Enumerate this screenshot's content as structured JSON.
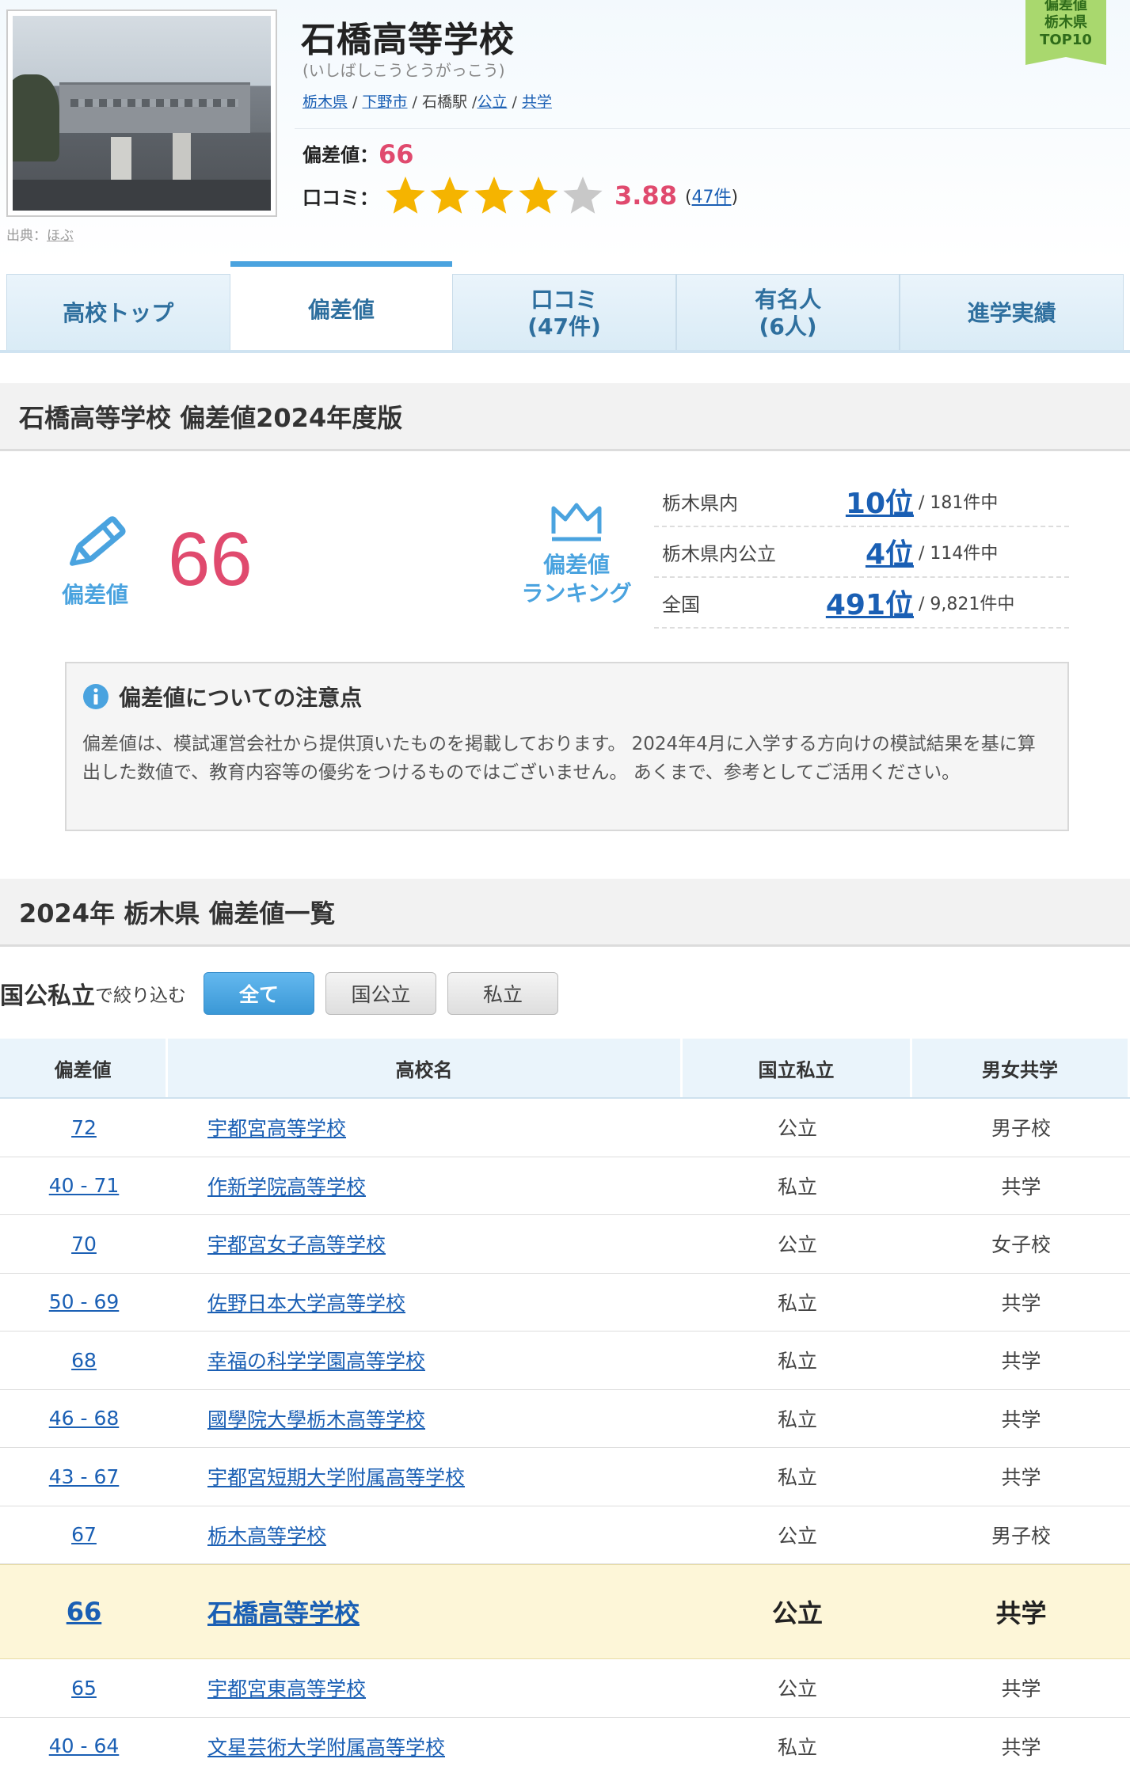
{
  "header": {
    "school_name": "石橋高等学校",
    "school_kana": "(いしばしこうとうがっこう)",
    "breadcrumb": {
      "pref": "栃木県",
      "city": "下野市",
      "sep1": " / ",
      "station": "石橋駅",
      "sep2": " /",
      "type": "公立",
      "sep3": " / ",
      "gender": "共学"
    },
    "hensachi_label": "偏差値：",
    "hensachi_value": "66",
    "review_label": "口コミ：",
    "rating": 3.88,
    "rating_text": "3.88",
    "review_count_open": "(",
    "review_count": "47件",
    "review_count_close": ")",
    "credit_label": "出典：",
    "credit_link": "ほぶ",
    "ribbon": [
      "偏差値",
      "栃木県",
      "TOP10"
    ]
  },
  "tabs": [
    {
      "line1": "高校トップ",
      "line2": ""
    },
    {
      "line1": "偏差値",
      "line2": ""
    },
    {
      "line1": "口コミ",
      "line2": "(47件)"
    },
    {
      "line1": "有名人",
      "line2": "(6人)"
    },
    {
      "line1": "進学実績",
      "line2": ""
    }
  ],
  "section1": {
    "title": "石橋高等学校 偏差値2024年度版",
    "big_label": "偏差値",
    "big_value": "66",
    "rank_label_1": "偏差値",
    "rank_label_2": "ランキング",
    "ranks": [
      {
        "label": "栃木県内",
        "value": "10位",
        "total": "/ 181件中"
      },
      {
        "label": "栃木県内公立",
        "value": "4位",
        "total": "/ 114件中"
      },
      {
        "label": "全国",
        "value": "491位",
        "total": "/ 9,821件中"
      }
    ],
    "notice_title": "偏差値についての注意点",
    "notice_text": "偏差値は、模試運営会社から提供頂いたものを掲載しております。 2024年4月に入学する方向けの模試結果を基に算出した数値で、教育内容等の優劣をつけるものではございません。 あくまで、参考としてご活用ください。"
  },
  "section2": {
    "title": "2024年 栃木県 偏差値一覧",
    "filter_label": "国公私立",
    "filter_sub": "で絞り込む",
    "filter_buttons": [
      "全て",
      "国公立",
      "私立"
    ],
    "columns": [
      "偏差値",
      "高校名",
      "国立私立",
      "男女共学"
    ],
    "rows": [
      {
        "score": "72",
        "name": "宇都宮高等学校",
        "type": "公立",
        "gender": "男子校"
      },
      {
        "score": "40 - 71",
        "name": "作新学院高等学校",
        "type": "私立",
        "gender": "共学"
      },
      {
        "score": "70",
        "name": "宇都宮女子高等学校",
        "type": "公立",
        "gender": "女子校"
      },
      {
        "score": "50 - 69",
        "name": "佐野日本大学高等学校",
        "type": "私立",
        "gender": "共学"
      },
      {
        "score": "68",
        "name": "幸福の科学学園高等学校",
        "type": "私立",
        "gender": "共学"
      },
      {
        "score": "46 - 68",
        "name": "國學院大學栃木高等学校",
        "type": "私立",
        "gender": "共学"
      },
      {
        "score": "43 - 67",
        "name": "宇都宮短期大学附属高等学校",
        "type": "私立",
        "gender": "共学"
      },
      {
        "score": "67",
        "name": "栃木高等学校",
        "type": "公立",
        "gender": "男子校"
      },
      {
        "score": "66",
        "name": "石橋高等学校",
        "type": "公立",
        "gender": "共学",
        "highlight": true
      },
      {
        "score": "65",
        "name": "宇都宮東高等学校",
        "type": "公立",
        "gender": "共学"
      },
      {
        "score": "40 - 64",
        "name": "文星芸術大学附属高等学校",
        "type": "私立",
        "gender": "共学"
      }
    ]
  },
  "colors": {
    "accent_blue": "#4aa3df",
    "link_blue": "#1a5fb4",
    "value_pink": "#e04a6e",
    "star_gold": "#f5b400",
    "highlight_row": "#fdf6d8"
  }
}
